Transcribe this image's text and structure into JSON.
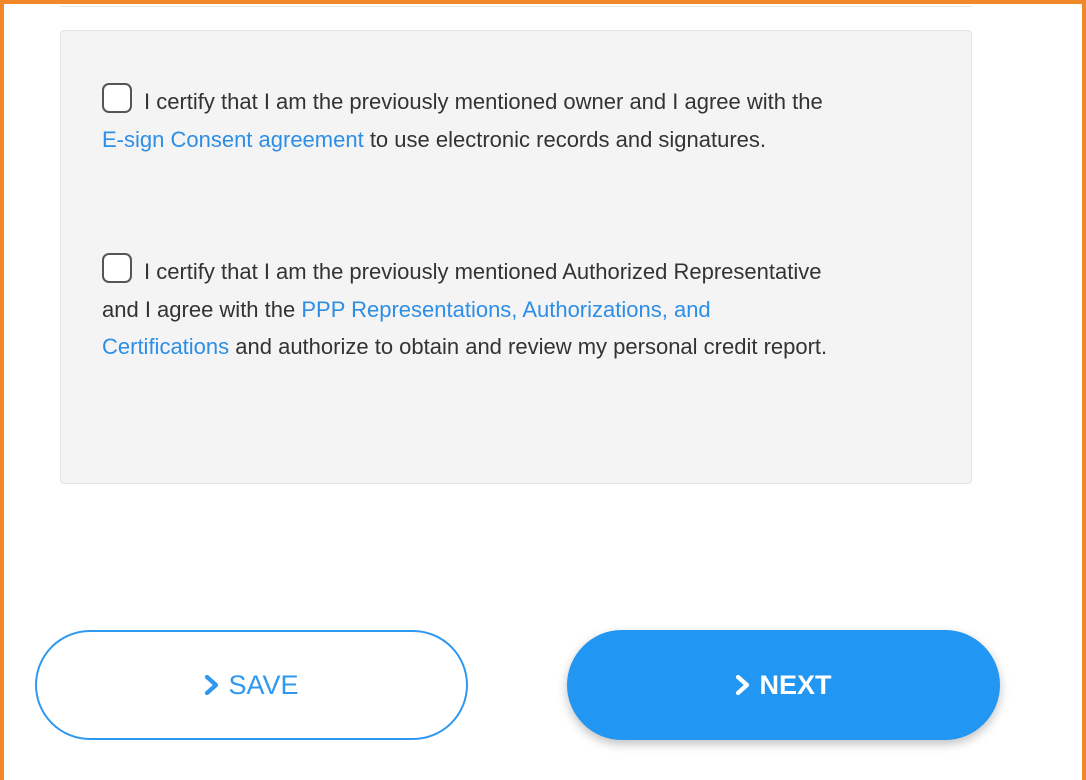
{
  "consents": {
    "item1": {
      "text_before": "I certify that I am the previously mentioned owner and I agree with the ",
      "link": "E-sign Consent agreement",
      "text_after": " to use electronic records and signatures."
    },
    "item2": {
      "text_before": "I certify that I am the previously mentioned Authorized Representative and I agree with the ",
      "link": "PPP Representations, Authorizations, and Certifications",
      "text_after": " and authorize to obtain and review my personal credit report."
    }
  },
  "buttons": {
    "save_label": "SAVE",
    "next_label": "NEXT"
  },
  "icons": {
    "checkbox": "checkbox-unchecked-icon",
    "chevron": "chevron-right-icon"
  },
  "colors": {
    "frame_border": "#f0882a",
    "panel_bg": "#f4f4f4",
    "link": "#2d8ee6",
    "primary": "#2196f3",
    "text": "#333333"
  }
}
